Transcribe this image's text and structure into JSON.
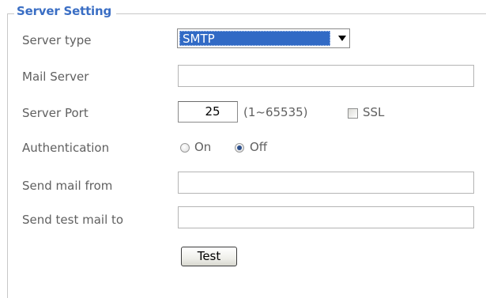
{
  "fieldset": {
    "legend": "Server Setting"
  },
  "server_type": {
    "label": "Server type",
    "selected": "SMTP"
  },
  "mail_server": {
    "label": "Mail Server",
    "value": ""
  },
  "server_port": {
    "label": "Server Port",
    "value": "25",
    "range": "(1~65535)",
    "ssl_label": "SSL",
    "ssl_checked": false
  },
  "authentication": {
    "label": "Authentication",
    "on_label": "On",
    "off_label": "Off",
    "selected": "Off"
  },
  "send_mail_from": {
    "label": "Send mail from",
    "value": ""
  },
  "send_test_mail_to": {
    "label": "Send test mail to",
    "value": ""
  },
  "actions": {
    "test_label": "Test"
  },
  "colors": {
    "legend": "#3a6ec4",
    "selection": "#316ac5",
    "label": "#606060"
  }
}
